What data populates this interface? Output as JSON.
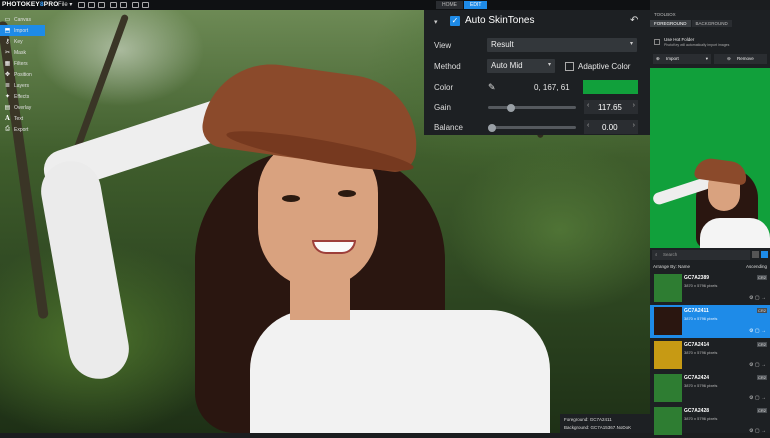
{
  "app": {
    "logo_main": "PHOTOKEY",
    "logo_accent": "8",
    "logo_suffix": "PRO",
    "file_menu": "File"
  },
  "tabs": [
    {
      "label": "HOME"
    },
    {
      "label": "EDIT"
    }
  ],
  "sidebar": {
    "items": [
      {
        "label": "Canvas",
        "icon": "canvas-icon"
      },
      {
        "label": "Import",
        "icon": "import-icon"
      },
      {
        "label": "Key",
        "icon": "key-icon"
      },
      {
        "label": "Mask",
        "icon": "mask-icon"
      },
      {
        "label": "Filters",
        "icon": "filters-icon"
      },
      {
        "label": "Position",
        "icon": "position-icon"
      },
      {
        "label": "Layers",
        "icon": "layers-icon"
      },
      {
        "label": "Effects",
        "icon": "effects-icon"
      },
      {
        "label": "Overlay",
        "icon": "overlay-icon"
      },
      {
        "label": "Text",
        "icon": "text-icon"
      },
      {
        "label": "Export",
        "icon": "export-icon"
      }
    ]
  },
  "panel": {
    "title": "Auto SkinTones",
    "enabled": true,
    "view_label": "View",
    "view_value": "Result",
    "method_label": "Method",
    "method_value": "Auto Mid",
    "adaptive_label": "Adaptive Color",
    "color_label": "Color",
    "color_value": "0, 167, 61",
    "color_hex": "#11a03b",
    "gain_label": "Gain",
    "gain_value": "117.65",
    "balance_label": "Balance",
    "balance_value": "0.00"
  },
  "right": {
    "toolbox_title": "TOOLBOX",
    "tab_fg": "FOREGROUND",
    "tab_bg": "BACKGROUND",
    "hot_folder_title": "Use Hot Folder",
    "hot_folder_desc": "PhotoKey will automatically import images",
    "import_label": "Import",
    "remove_label": "Remove",
    "search_placeholder": "Search",
    "arrange_label": "Arrange By: Name",
    "order_label": "Ascending",
    "files": [
      {
        "name": "GC7A2389",
        "size": "3870 x 5796 pixels",
        "badge": "CR2",
        "active": false
      },
      {
        "name": "GC7A2411",
        "size": "3870 x 5796 pixels",
        "badge": "CR2",
        "active": true
      },
      {
        "name": "GC7A2414",
        "size": "3870 x 5796 pixels",
        "badge": "CR2",
        "active": false
      },
      {
        "name": "GC7A2424",
        "size": "3870 x 5796 pixels",
        "badge": "CR2",
        "active": false
      },
      {
        "name": "GC7A2428",
        "size": "3870 x 5796 pixels",
        "badge": "CR2",
        "active": false
      }
    ]
  },
  "status": {
    "fg_label": "Foreground:",
    "fg_value": "GC7A2411",
    "bg_label": "Background:",
    "bg_value": "GC7A15367.NoDoK"
  },
  "colors": {
    "accent": "#1e8be8",
    "green_screen": "#11a03b"
  }
}
